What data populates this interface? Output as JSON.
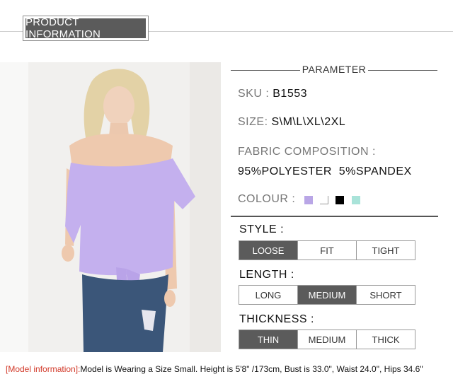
{
  "header": {
    "title": "PRODUCT INFORMATION"
  },
  "parameter": {
    "title": "PARAMETER"
  },
  "specs": {
    "sku": {
      "label": "SKU :",
      "value": "B1553"
    },
    "size": {
      "label": "SIZE:",
      "value": "S\\M\\L\\XL\\2XL"
    },
    "fabric": {
      "label": "FABRIC COMPOSITION :",
      "value": "95%POLYESTER  5%SPANDEX"
    },
    "colour": {
      "label": "COLOUR :",
      "swatches": [
        "#b9a6e6",
        "#ffffff",
        "#000000",
        "#a9e3d9"
      ]
    }
  },
  "style": {
    "label": "STYLE :",
    "options": [
      "LOOSE",
      "FIT",
      "TIGHT"
    ],
    "selected": "LOOSE"
  },
  "length": {
    "label": "LENGTH :",
    "options": [
      "LONG",
      "MEDIUM",
      "SHORT"
    ],
    "selected": "MEDIUM"
  },
  "thickness": {
    "label": "THICKNESS :",
    "options": [
      "THIN",
      "MEDIUM",
      "THICK"
    ],
    "selected": "THIN"
  },
  "footer": {
    "prefix": "[Model information]:",
    "text": "Model is Wearing a Size Small. Height is 5'8\" /173cm, Bust is 33.0\", Waist 24.0\", Hips 34.6\""
  },
  "colors": {
    "accent_dark": "#5b5b5b",
    "footer_red": "#d23a2a",
    "top_lilac": "#c4b0ee"
  }
}
